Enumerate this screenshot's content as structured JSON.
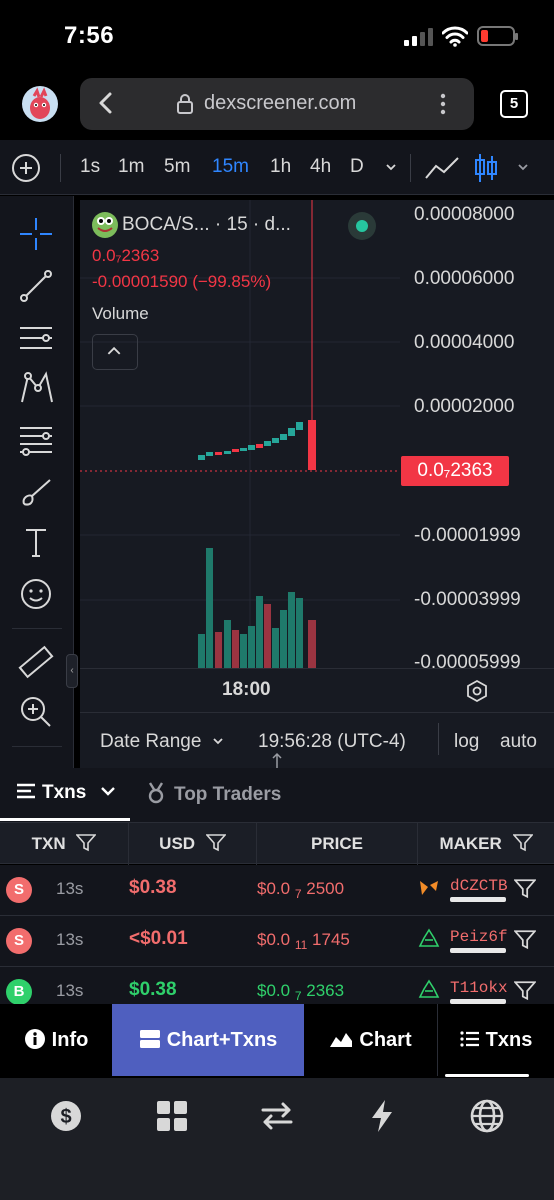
{
  "status_bar": {
    "time": "7:56"
  },
  "browser": {
    "url": "dexscreener.com",
    "tab_count": "5"
  },
  "chart_toolbar": {
    "intervals": [
      "1s",
      "1m",
      "5m",
      "15m",
      "1h",
      "4h",
      "D"
    ],
    "active_interval": "15m"
  },
  "chart": {
    "legend_title": "BOCA/S...  · 15 · d...",
    "price_now": "0.0₇2363",
    "price_change": "-0.00001590 (−99.85%)",
    "volume_label": "Volume",
    "y_axis_labels": [
      "0.00008000",
      "0.00006000",
      "0.00004000",
      "0.00002000",
      "-0.00001999",
      "-0.00003999",
      "-0.00005999"
    ],
    "price_tag": "0.0₇2363",
    "time_label": "18:00",
    "date_range_label": "Date Range",
    "clock": "19:56:28 (UTC-4)",
    "log_label": "log",
    "auto_label": "auto"
  },
  "txn_panel": {
    "tabs": {
      "txns": "Txns",
      "top_traders": "Top Traders"
    },
    "headers": {
      "txn": "TXN",
      "usd": "USD",
      "price": "PRICE",
      "maker": "MAKER"
    },
    "rows": [
      {
        "type": "S",
        "age": "13s",
        "usd": "$0.38",
        "price_pre": "$0.0",
        "price_sub": "7",
        "price_post": "2500",
        "maker": "dCZCTB",
        "side": "sell"
      },
      {
        "type": "S",
        "age": "13s",
        "usd": "<$0.01",
        "price_pre": "$0.0",
        "price_sub": "11",
        "price_post": "1745",
        "maker": "Peiz6f",
        "side": "sell"
      },
      {
        "type": "B",
        "age": "13s",
        "usd": "$0.38",
        "price_pre": "$0.0",
        "price_sub": "7",
        "price_post": "2363",
        "maker": "T11okx",
        "side": "buy"
      }
    ]
  },
  "view_tabs": {
    "info": "Info",
    "chart_txns": "Chart+Txns",
    "chart": "Chart",
    "txns": "Txns"
  },
  "bottom_nav": [
    "dollar-icon",
    "grid-icon",
    "swap-icon",
    "bolt-icon",
    "globe-icon"
  ],
  "colors": {
    "sell": "#f26d6d",
    "buy": "#2fd06b",
    "accent": "#2f86ff",
    "active_view": "#4f5fbf",
    "candle_up": "#26a69a",
    "candle_down": "#f23645"
  }
}
